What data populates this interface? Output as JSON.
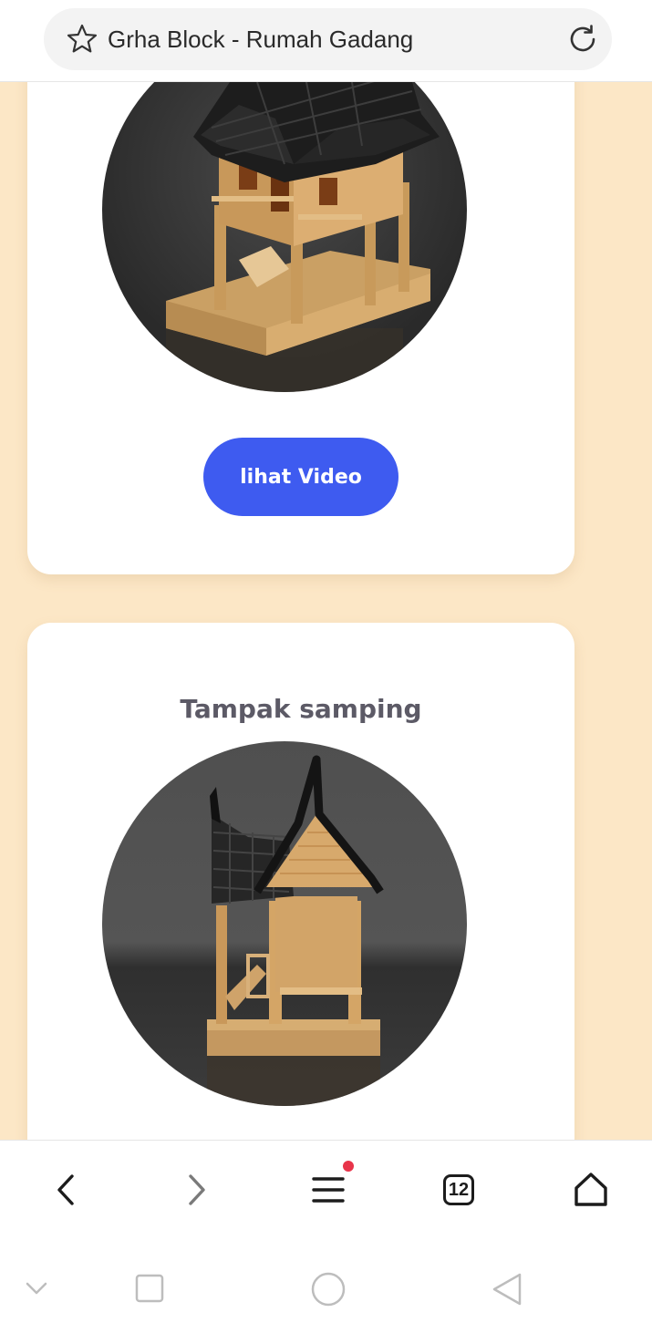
{
  "browser": {
    "page_title": "Grha Block - Rumah Gadang",
    "tab_count": "12"
  },
  "cards": [
    {
      "button_label": "lihat Video"
    },
    {
      "title": "Tampak samping"
    }
  ],
  "colors": {
    "page_bg": "#fce7c6",
    "button": "#3e5bf0",
    "notification_dot": "#e8344a"
  },
  "icons": {
    "url_left": "star-icon",
    "url_right": "reload-icon",
    "nav": [
      "back-icon",
      "forward-icon",
      "menu-icon",
      "tabs-icon",
      "home-icon"
    ],
    "system": [
      "collapse-icon",
      "recents-icon",
      "home-circle-icon",
      "back-triangle-icon"
    ]
  }
}
